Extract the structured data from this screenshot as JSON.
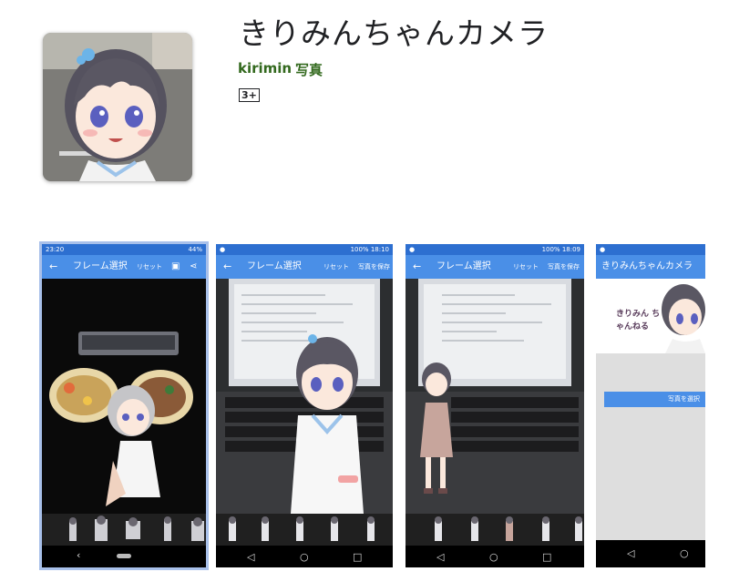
{
  "app": {
    "title": "きりみんちゃんカメラ",
    "developer": "kirimin",
    "category": "写真",
    "content_rating": "3+"
  },
  "colors": {
    "accent": "#33691e",
    "appbar": "#4a8fe7",
    "statusbar": "#2d6fd0"
  },
  "screenshots": [
    {
      "status_time": "23:20",
      "status_battery": "44%",
      "title": "フレーム選択",
      "reset_label": "リセット",
      "save_icon": "save-icon",
      "share_icon": "share-icon"
    },
    {
      "status_time": "18:10",
      "status_battery": "100%",
      "title": "フレーム選択",
      "reset_label": "リセット",
      "save_label": "写真を保存"
    },
    {
      "status_time": "18:09",
      "status_battery": "100%",
      "title": "フレーム選択",
      "reset_label": "リセット",
      "save_label": "写真を保存"
    },
    {
      "title": "きりみんちゃんカメラ",
      "banner_text": "きりみん ちゃんねる",
      "button_label": "写真を選択"
    }
  ]
}
